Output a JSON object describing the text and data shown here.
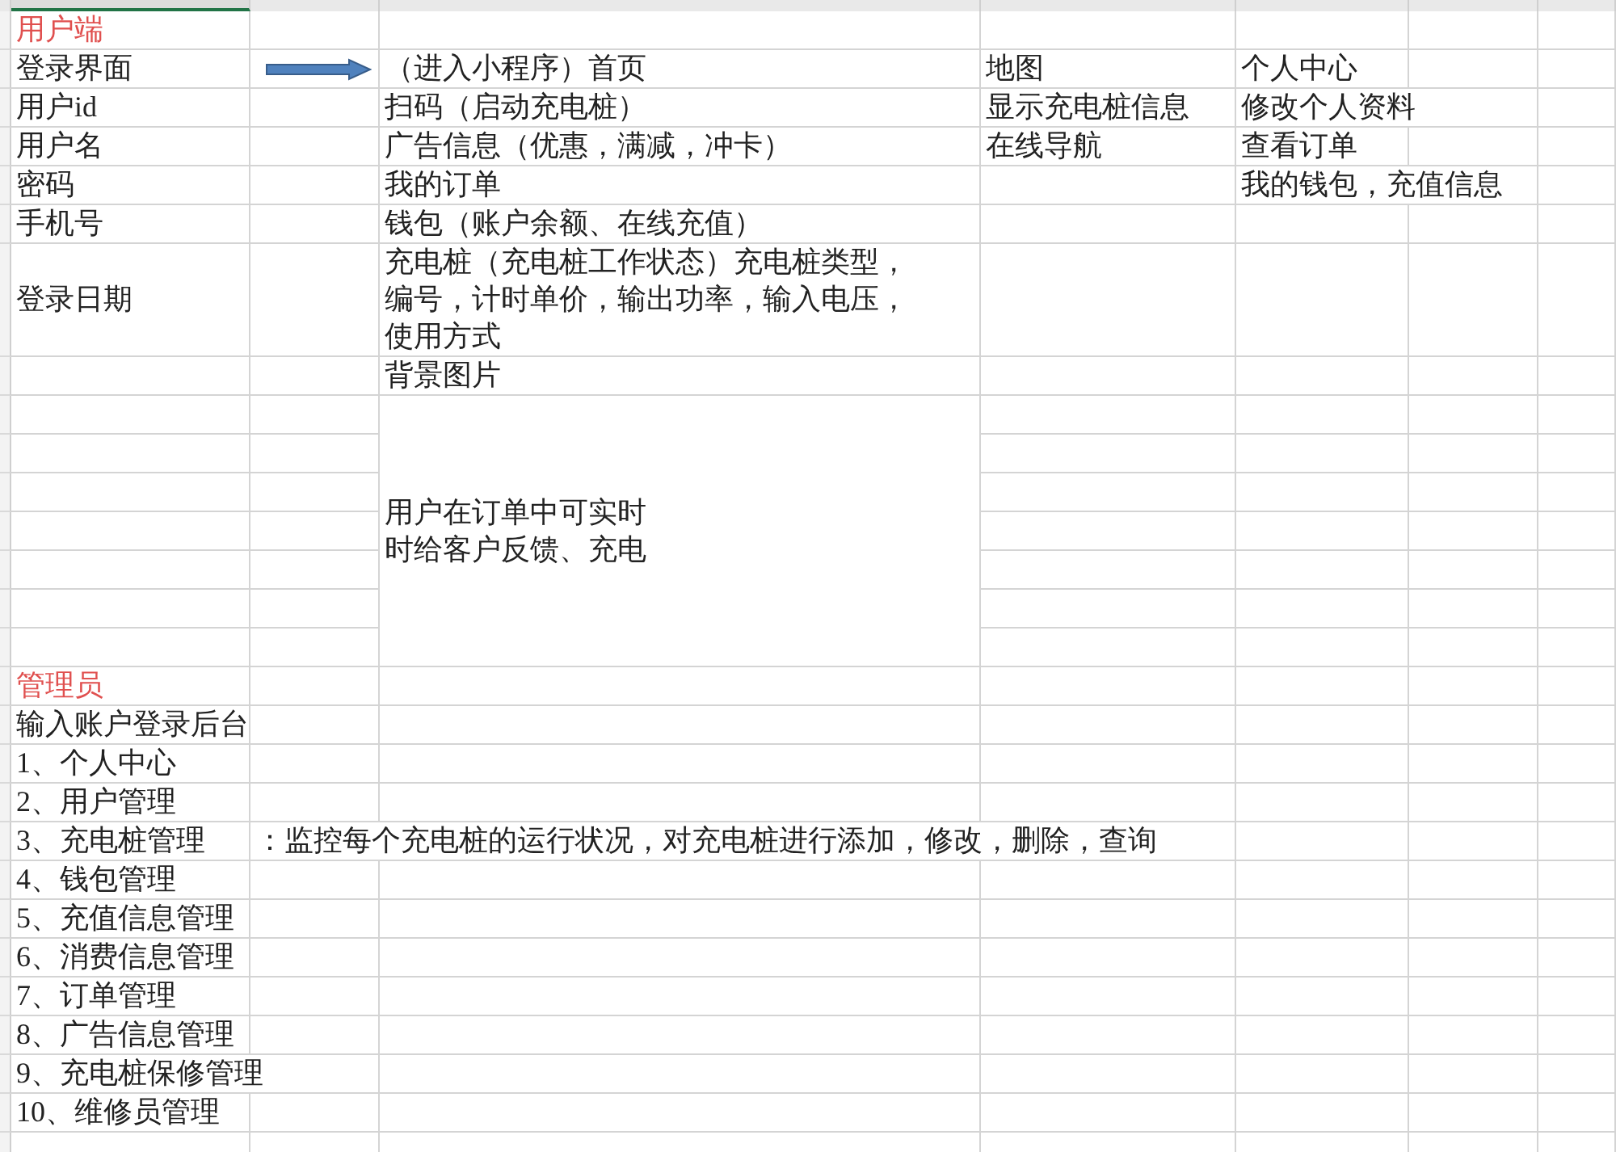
{
  "sheet": {
    "rows": [
      {
        "kind": "section",
        "column_1": "用户端"
      },
      {
        "kind": "data",
        "column_1": "登录界面",
        "arrow": true,
        "column_3": "（进入小程序）首页",
        "column_4": "地图",
        "column_5": "个人中心"
      },
      {
        "kind": "data",
        "column_1": "用户id",
        "column_3": "扫码（启动充电桩）",
        "column_4": "显示充电桩信息",
        "column_5": "修改个人资料"
      },
      {
        "kind": "data",
        "column_1": "用户名",
        "column_3": "广告信息（优惠，满减，冲卡）",
        "column_4": "在线导航",
        "column_5": "查看订单"
      },
      {
        "kind": "data",
        "column_1": "密码",
        "column_3": "我的订单",
        "column_5": "我的钱包，充值信息"
      },
      {
        "kind": "data",
        "column_1": "手机号",
        "column_3": "钱包（账户余额、在线充值）"
      },
      {
        "kind": "wrapped",
        "column_1": "登录日期",
        "column_3": "充电桩（充电桩工作状态）充电桩类型，编号，计时单价，输出功率，输入电压，使用方式"
      },
      {
        "kind": "data",
        "column_3": "背景图片"
      },
      {
        "kind": "merged",
        "column_3": "用户在订单中可实时时给客户反馈、充电"
      },
      {
        "kind": "section",
        "column_1": "管理员"
      },
      {
        "kind": "data",
        "column_1": "输入账户登录后台"
      },
      {
        "kind": "data",
        "column_1": "1、个人中心"
      },
      {
        "kind": "data",
        "column_1": "2、用户管理"
      },
      {
        "kind": "data",
        "column_1": "3、充电桩管理",
        "column_2": "：监控每个充电桩的运行状况，对充电桩进行添加，修改，删除，查询"
      },
      {
        "kind": "data",
        "column_1": "4、钱包管理"
      },
      {
        "kind": "data",
        "column_1": "5、充值信息管理"
      },
      {
        "kind": "data",
        "column_1": "6、消费信息管理"
      },
      {
        "kind": "data",
        "column_1": "7、订单管理"
      },
      {
        "kind": "data",
        "column_1": "8、广告信息管理"
      },
      {
        "kind": "data",
        "column_1": "9、充电桩保修管理"
      },
      {
        "kind": "data",
        "column_1": "10、维修员管理"
      }
    ]
  }
}
